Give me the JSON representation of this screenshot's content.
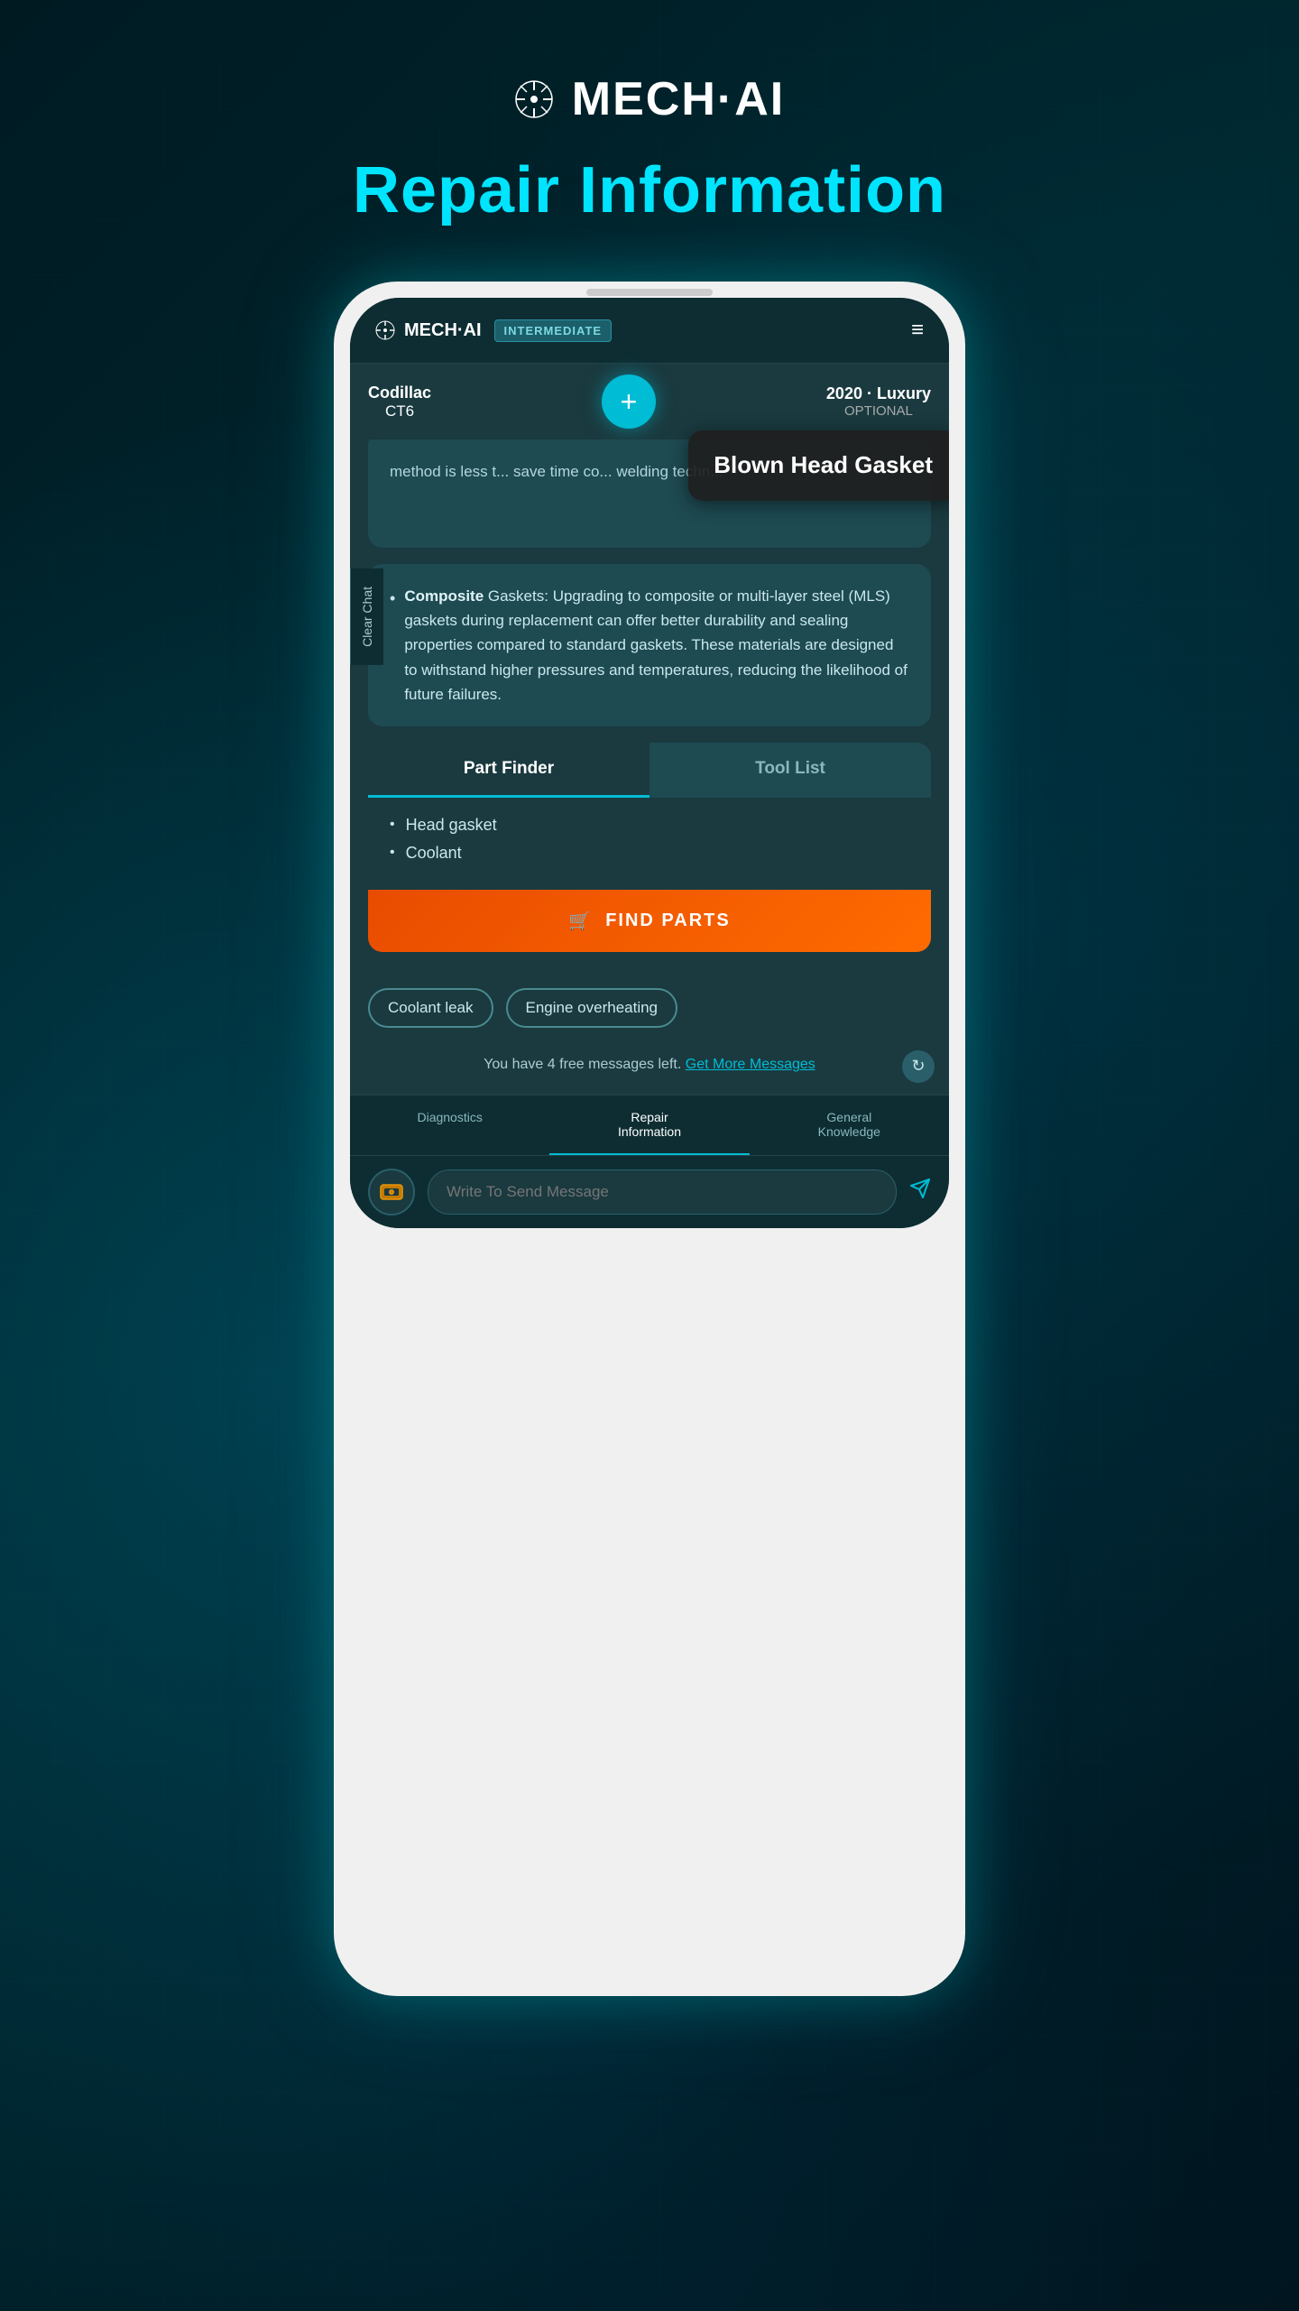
{
  "page": {
    "logo_text": "MECH·AI",
    "logo_dot": "·",
    "title": "Repair Information"
  },
  "app": {
    "logo": "MECH·AI",
    "badge": "INTERMEDIATE",
    "hamburger": "≡",
    "vehicle_left_line1": "Codillac",
    "vehicle_left_line2": "CT6",
    "vehicle_right_line1": "2020 · Luxury",
    "vehicle_right_line2": "OPTIONAL",
    "add_btn": "+",
    "clear_chat": "Clear Chat"
  },
  "tooltip": {
    "text": "Blown Head Gasket"
  },
  "message": {
    "partial_text": "method is less t... save time co... welding techn...",
    "bullet_label": "Composite",
    "bullet_rest": " Gaskets:",
    "bullet_desc": " Upgrading to composite or multi-layer steel (MLS) gaskets during replacement can offer better durability and sealing properties compared to standard gaskets. These materials are designed to withstand higher pressures and temperatures, reducing the likelihood of future failures."
  },
  "part_finder": {
    "tab_active": "Part Finder",
    "tab_inactive": "Tool List",
    "parts": [
      "Head gasket",
      "Coolant"
    ],
    "find_btn": "FIND PARTS",
    "cart_icon": "🛒"
  },
  "chips": [
    "Coolant leak",
    "Engine overheating"
  ],
  "free_messages": {
    "text": "You have 4 free messages left.",
    "link": "Get More Messages"
  },
  "bottom_nav": [
    {
      "label": "Diagnostics",
      "active": false
    },
    {
      "label": "Repair\nInformation",
      "active": true
    },
    {
      "label": "General\nKnowledge",
      "active": false
    }
  ],
  "input": {
    "placeholder": "Write To Send Message"
  }
}
